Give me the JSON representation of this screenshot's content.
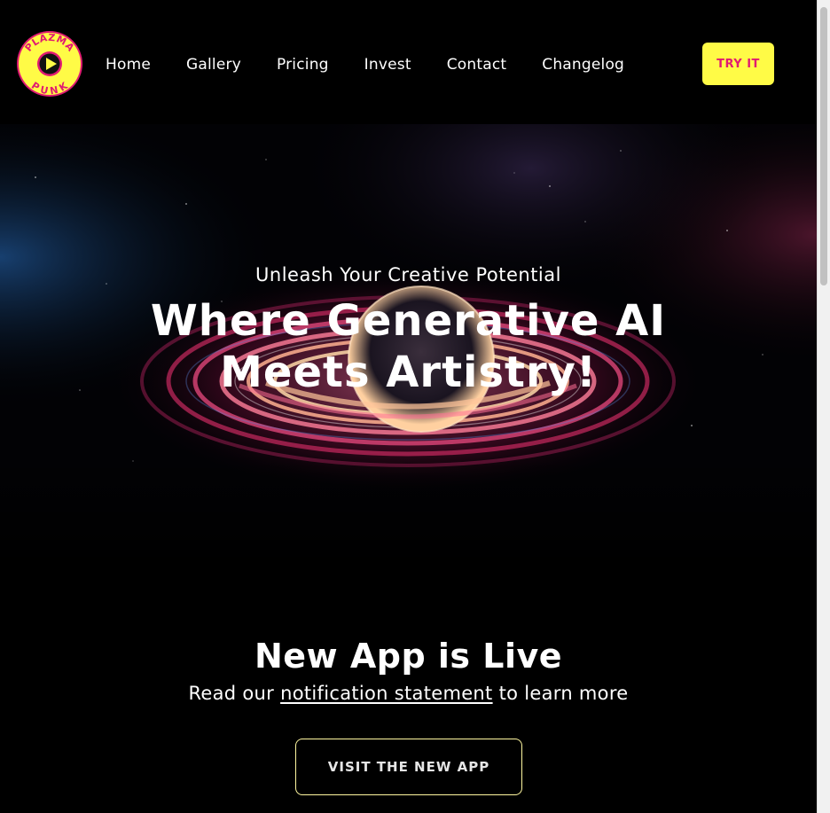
{
  "brand": {
    "logo_top": "PLAZMA",
    "logo_bottom": "PUNK",
    "colors": {
      "yellow": "#fffb46",
      "pink": "#e01a72"
    }
  },
  "nav": {
    "items": [
      {
        "label": "Home"
      },
      {
        "label": "Gallery"
      },
      {
        "label": "Pricing"
      },
      {
        "label": "Invest"
      },
      {
        "label": "Contact"
      },
      {
        "label": "Changelog"
      }
    ],
    "cta_label": "TRY IT"
  },
  "hero": {
    "subtitle": "Unleash Your Creative Potential",
    "title": "Where Generative AI Meets Artistry!"
  },
  "announcement": {
    "title": "New App is Live",
    "text_before": "Read our",
    "link_text": "notification statement",
    "text_after": "to learn more",
    "button_label": "VISIT THE NEW APP"
  }
}
